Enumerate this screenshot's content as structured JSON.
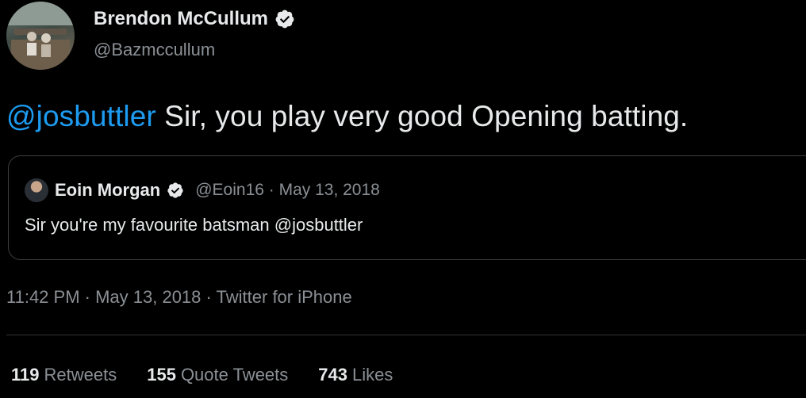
{
  "author": {
    "name": "Brendon McCullum",
    "handle": "@Bazmccullum",
    "verified": true
  },
  "tweet": {
    "mention": "@josbuttler",
    "text": " Sir, you play very good Opening batting."
  },
  "quoted_tweet": {
    "name": "Eoin Morgan",
    "verified": true,
    "meta": "@Eoin16 · May 13, 2018",
    "text": "Sir you're my favourite batsman @josbuttler"
  },
  "timestamp": "11:42 PM · May 13, 2018 · Twitter for iPhone",
  "stats": [
    {
      "count": "119",
      "label": "Retweets"
    },
    {
      "count": "155",
      "label": "Quote Tweets"
    },
    {
      "count": "743",
      "label": "Likes"
    }
  ],
  "colors": {
    "background": "#000000",
    "mention": "#1d9bf0",
    "secondary_text": "#8b9095",
    "primary_text": "#e7e9ea"
  }
}
